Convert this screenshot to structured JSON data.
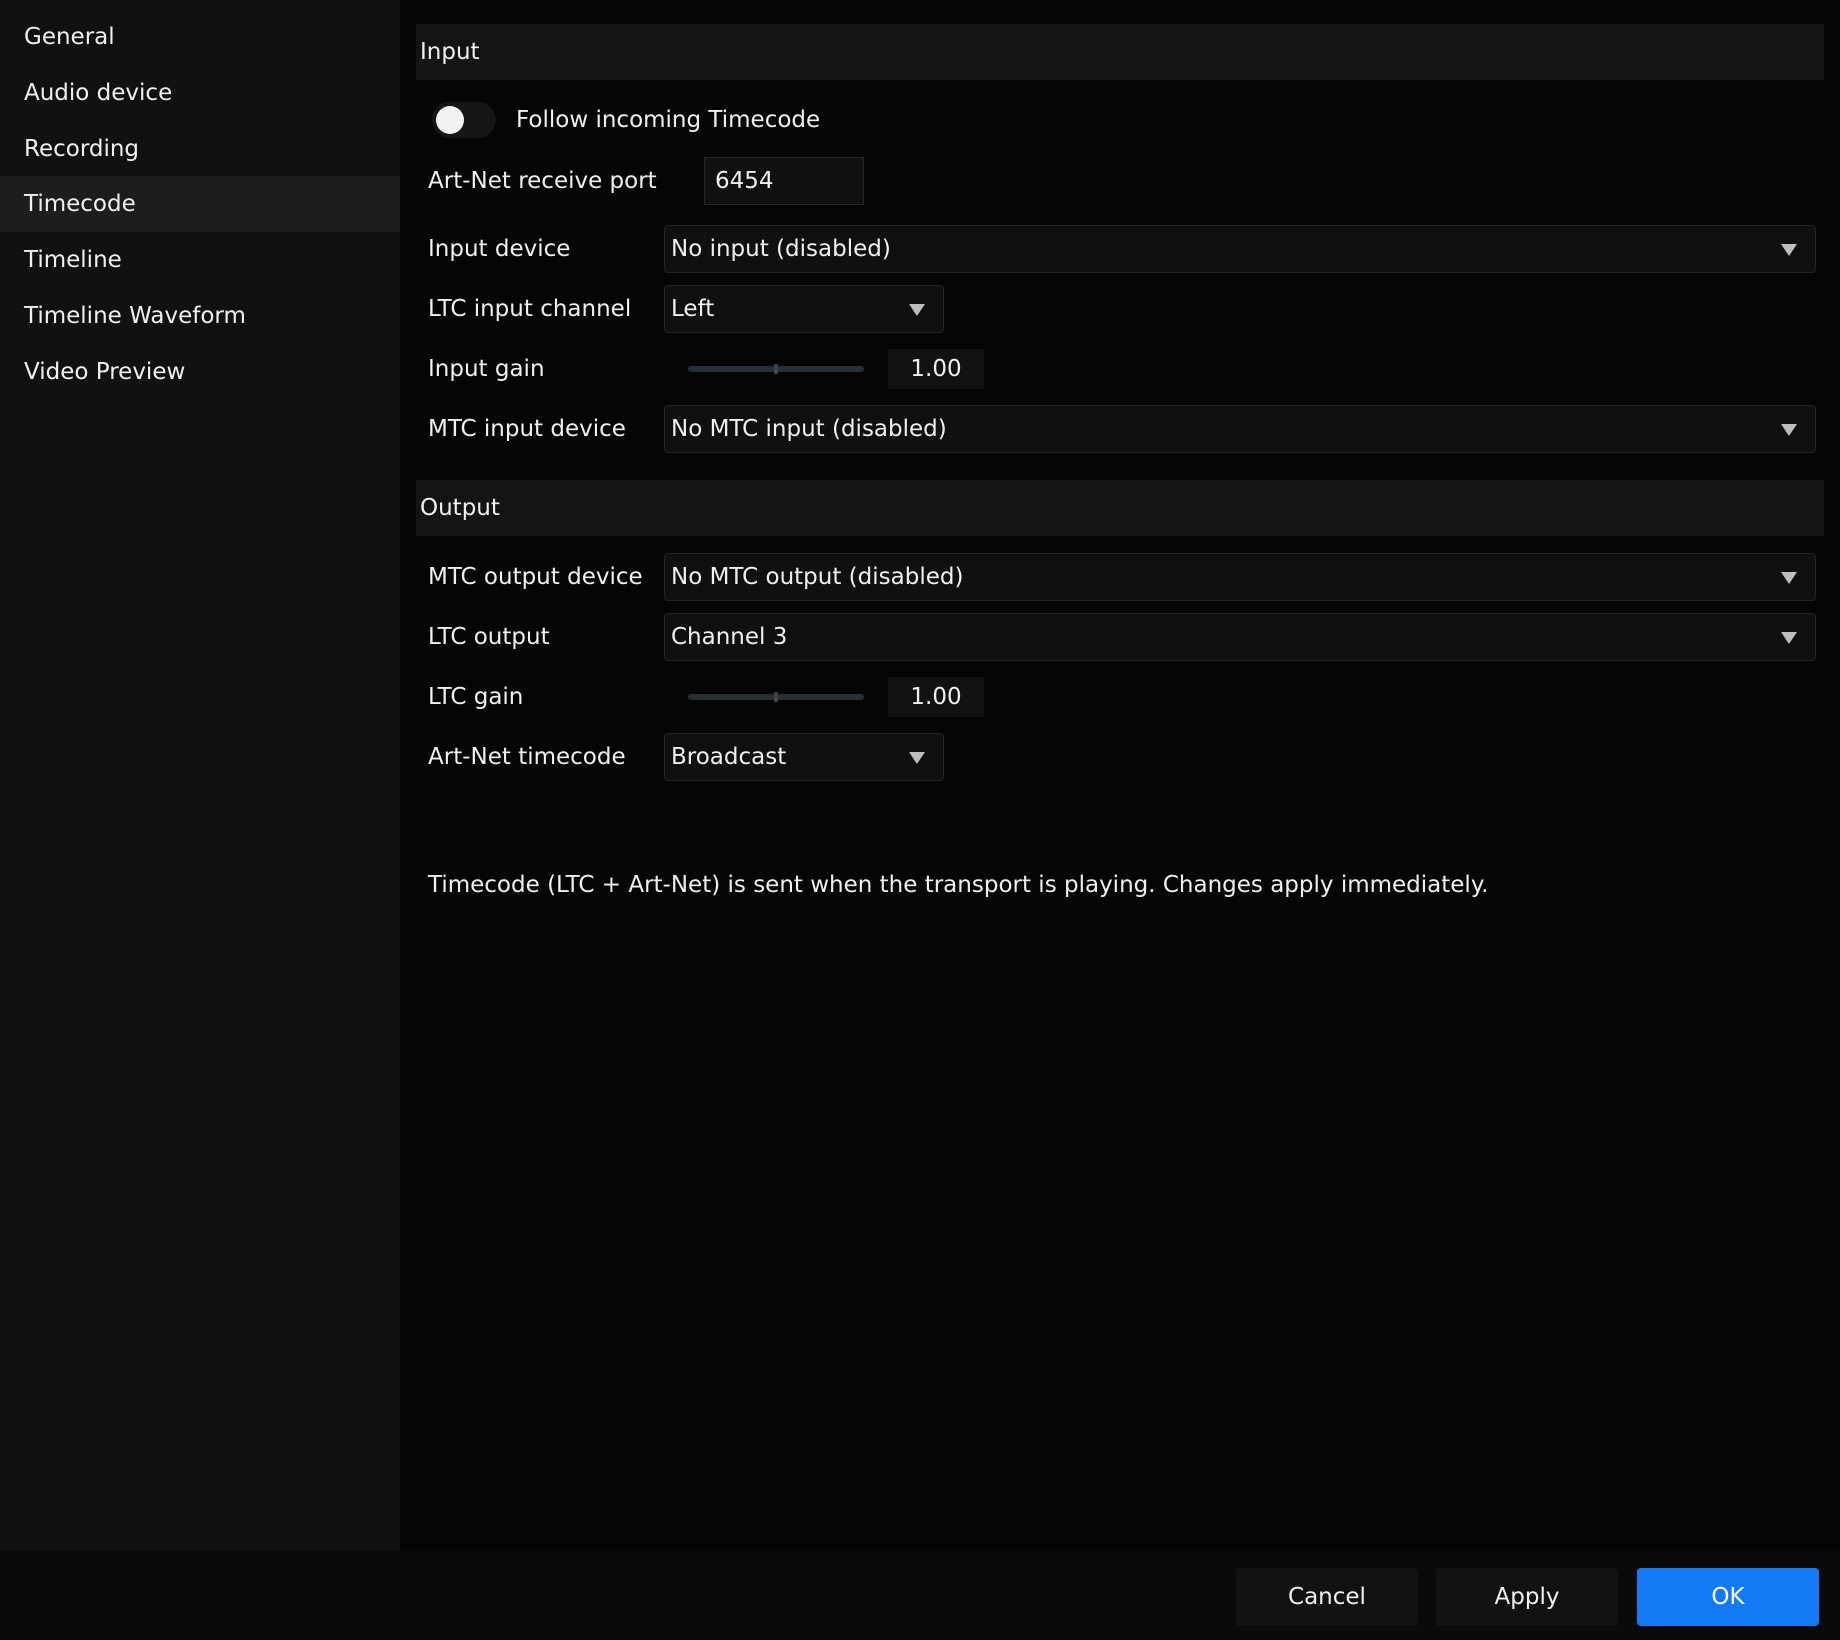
{
  "sidebar": {
    "items": [
      {
        "label": "General"
      },
      {
        "label": "Audio device"
      },
      {
        "label": "Recording"
      },
      {
        "label": "Timecode",
        "active": true
      },
      {
        "label": "Timeline"
      },
      {
        "label": "Timeline Waveform"
      },
      {
        "label": "Video Preview"
      }
    ]
  },
  "input_section": {
    "title": "Input",
    "follow_toggle": {
      "label": "Follow incoming Timecode",
      "on": false
    },
    "artnet_port": {
      "label": "Art-Net receive port",
      "value": "6454"
    },
    "input_device": {
      "label": "Input device",
      "value": "No input (disabled)"
    },
    "ltc_channel": {
      "label": "LTC input channel",
      "value": "Left"
    },
    "input_gain": {
      "label": "Input gain",
      "value": "1.00",
      "level": 0.5
    },
    "mtc_input": {
      "label": "MTC input device",
      "value": "No MTC input (disabled)"
    }
  },
  "output_section": {
    "title": "Output",
    "mtc_output": {
      "label": "MTC output device",
      "value": "No MTC output (disabled)"
    },
    "ltc_output": {
      "label": "LTC output",
      "value": "Channel 3"
    },
    "ltc_gain": {
      "label": "LTC gain",
      "value": "1.00",
      "level": 0.5
    },
    "artnet_timecode": {
      "label": "Art-Net timecode",
      "value": "Broadcast"
    }
  },
  "info": "Timecode (LTC + Art-Net) is sent when the transport is playing. Changes apply immediately.",
  "footer": {
    "cancel": "Cancel",
    "apply": "Apply",
    "ok": "OK"
  },
  "colors": {
    "accent": "#1479f5",
    "background": "#050505",
    "sidebar": "#111111",
    "sidebar_active": "#1d1d1d"
  }
}
